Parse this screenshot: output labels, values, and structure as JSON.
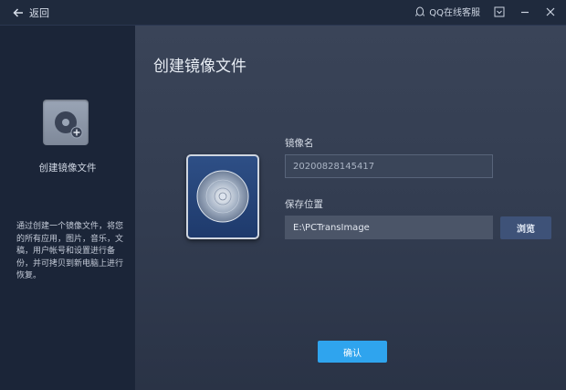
{
  "titlebar": {
    "back_label": "返回",
    "support_label": "QQ在线客服",
    "icons": [
      "back-arrow-icon",
      "qq-penguin-icon",
      "dropdown-menu-icon",
      "minimize-icon",
      "close-icon"
    ]
  },
  "sidebar": {
    "item_title": "创建镜像文件",
    "description": "通过创建一个镜像文件，将您的所有应用，图片，音乐，文稿，用户帐号和设置进行备份，并可拷贝到新电脑上进行恢复。",
    "icon": "disc-add-icon"
  },
  "main": {
    "title": "创建镜像文件",
    "image_name_label": "镜像名",
    "image_name_value": "20200828145417",
    "save_location_label": "保存位置",
    "save_location_value": "E:\\PCTransImage",
    "browse_label": "浏览",
    "confirm_label": "确认",
    "image_icon": "disc-image-icon"
  },
  "colors": {
    "titlebar_bg": "#1f2a3d",
    "sidebar_bg": "#1b2538",
    "main_bg": "#363f53",
    "accent": "#2fa4ee",
    "browse_bg": "#3e5278"
  }
}
